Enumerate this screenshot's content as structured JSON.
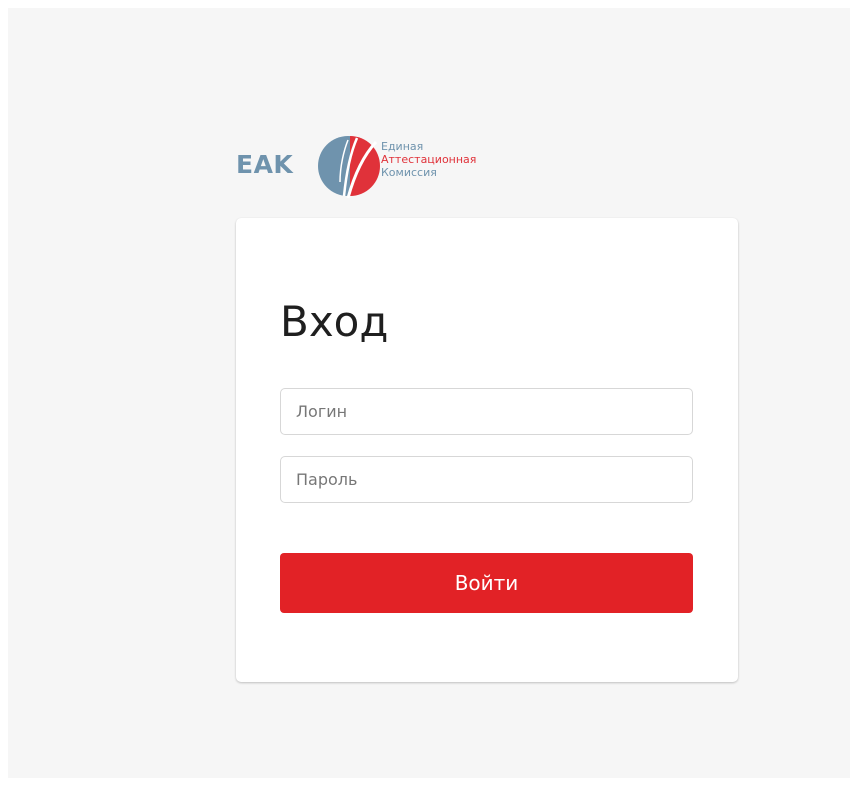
{
  "logo": {
    "abbreviation": "EAK",
    "line1": "Единая",
    "line2": "Аттестационная",
    "line3": "Комиссия",
    "colors": {
      "blue": "#6f93ad",
      "red": "#e0323a"
    }
  },
  "form": {
    "title": "Вход",
    "login": {
      "placeholder": "Логин",
      "value": ""
    },
    "password": {
      "placeholder": "Пароль",
      "value": ""
    },
    "submit_label": "Войти",
    "submit_color": "#e22226"
  }
}
